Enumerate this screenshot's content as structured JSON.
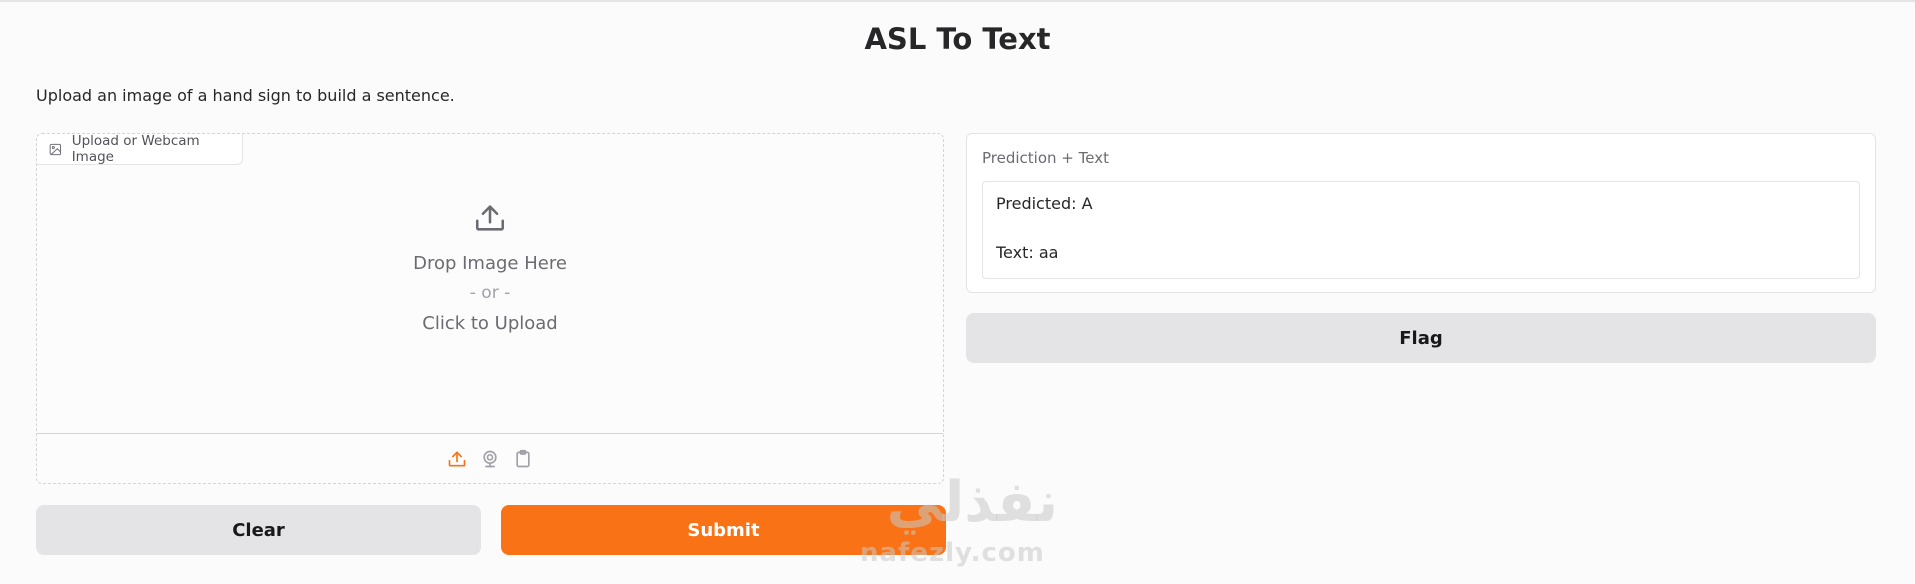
{
  "app": {
    "title": "ASL To Text",
    "description": "Upload an image of a hand sign to build a sentence."
  },
  "input": {
    "label": "Upload or Webcam Image",
    "drop_main": "Drop Image Here",
    "drop_or": "- or -",
    "drop_click": "Click to Upload",
    "sources": [
      "upload-icon",
      "webcam-icon",
      "clipboard-icon"
    ],
    "active_source_color": "#f97316"
  },
  "output": {
    "label": "Prediction + Text",
    "lines": [
      "Predicted: A",
      "Text: aa"
    ]
  },
  "buttons": {
    "clear": "Clear",
    "submit": "Submit",
    "flag": "Flag"
  },
  "watermark": {
    "arabic": "نفذلي",
    "latin": "nafezly.com"
  },
  "colors": {
    "accent": "#f97316",
    "secondary_button": "#e4e4e7"
  }
}
